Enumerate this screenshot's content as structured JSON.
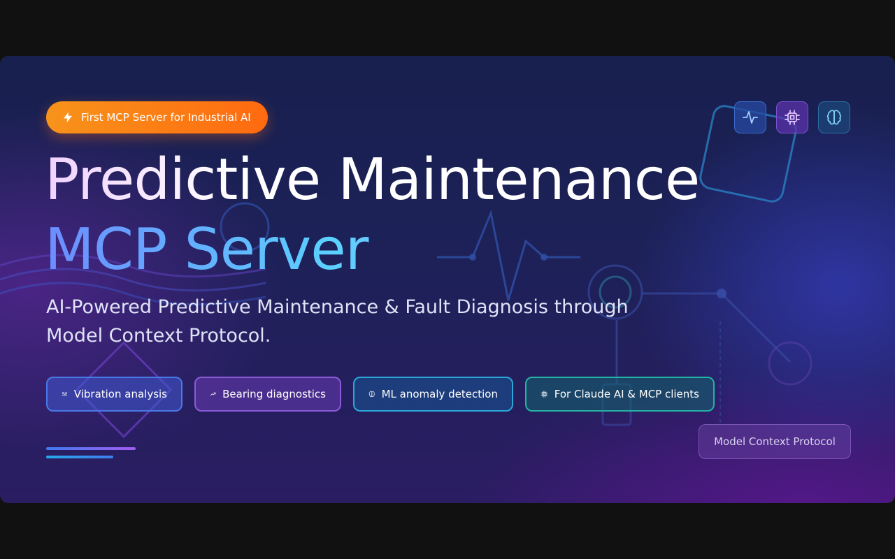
{
  "badge": {
    "label": "First MCP Server for Industrial AI",
    "icon": "lightning-icon"
  },
  "title": {
    "line1": "Predictive Maintenance",
    "line2": "MCP Server"
  },
  "subtitle": {
    "line1": "AI-Powered Predictive Maintenance & Fault Diagnosis through",
    "line2": "Model Context Protocol."
  },
  "chips": [
    {
      "label": "Vibration analysis",
      "icon": "waves-icon"
    },
    {
      "label": "Bearing diagnostics",
      "icon": "trending-up-icon"
    },
    {
      "label": "ML anomaly detection",
      "icon": "brain-icon"
    },
    {
      "label": "For Claude AI & MCP clients",
      "icon": "cpu-icon"
    }
  ],
  "top_icons": [
    {
      "icon": "activity-icon"
    },
    {
      "icon": "cpu-icon"
    },
    {
      "icon": "brain-icon"
    }
  ],
  "protocol_tag": {
    "label": "Model Context Protocol"
  },
  "colors": {
    "badge_start": "#f7931a",
    "badge_end": "#ff6a10",
    "background_top": "#18204f",
    "background_bottom": "#2a1d62",
    "accent_blue": "#3f7cf0",
    "accent_purple": "#a45cf0",
    "accent_cyan": "#2aa7d8",
    "accent_teal": "#23b3a2"
  }
}
